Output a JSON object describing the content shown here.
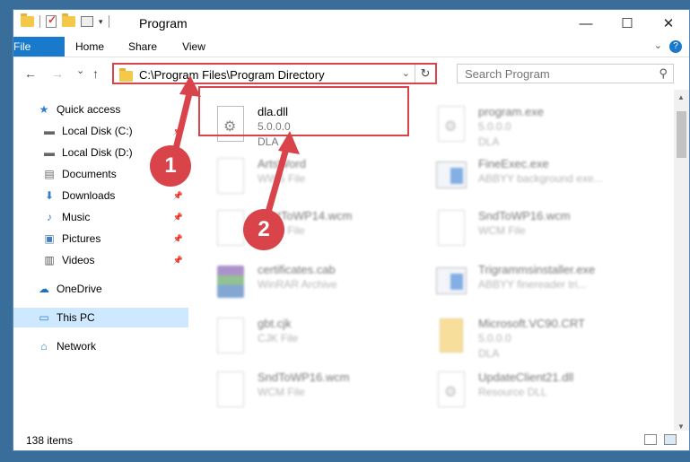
{
  "window": {
    "title": "Program",
    "controls": {
      "minimize": "—",
      "maximize": "☐",
      "close": "✕"
    }
  },
  "ribbon": {
    "tabs": [
      "File",
      "Home",
      "Share",
      "View"
    ],
    "help": "?"
  },
  "navigation": {
    "back": "←",
    "forward": "→",
    "recent": "⌄",
    "up": "↑",
    "address": "C:\\Program Files\\Program Directory",
    "refresh": "↻",
    "search_placeholder": "Search Program",
    "search_icon": "⚲"
  },
  "sidebar": {
    "items": [
      {
        "label": "Quick access",
        "icon": "star-icon",
        "glyph": "★",
        "color": "#2f7fd1"
      },
      {
        "label": "Local Disk (C:)",
        "icon": "drive-icon",
        "glyph": "▬",
        "color": "#666",
        "pinned": true
      },
      {
        "label": "Local Disk (D:)",
        "icon": "drive-icon",
        "glyph": "▬",
        "color": "#666",
        "pinned": true
      },
      {
        "label": "Documents",
        "icon": "documents-icon",
        "glyph": "▤",
        "color": "#666",
        "pinned": true
      },
      {
        "label": "Downloads",
        "icon": "download-icon",
        "glyph": "⬇",
        "color": "#2f7fd1",
        "pinned": true
      },
      {
        "label": "Music",
        "icon": "music-icon",
        "glyph": "♪",
        "color": "#2f7fd1",
        "pinned": true
      },
      {
        "label": "Pictures",
        "icon": "pictures-icon",
        "glyph": "▣",
        "color": "#4a7fb0",
        "pinned": true
      },
      {
        "label": "Videos",
        "icon": "videos-icon",
        "glyph": "▥",
        "color": "#555",
        "pinned": true
      },
      {
        "label": "OneDrive",
        "icon": "cloud-icon",
        "glyph": "☁",
        "color": "#1f6fc0"
      },
      {
        "label": "This PC",
        "icon": "computer-icon",
        "glyph": "▭",
        "color": "#2f7fd1",
        "selected": true
      },
      {
        "label": "Network",
        "icon": "network-icon",
        "glyph": "⌂",
        "color": "#2f7fd1"
      }
    ]
  },
  "files": [
    {
      "name": "dla.dll",
      "line2": "5.0.0.0",
      "line3": "DLA",
      "kind": "dll",
      "blur": false
    },
    {
      "name": "program.exe",
      "line2": "5.0.0.0",
      "line3": "DLA",
      "kind": "dll",
      "blur": true
    },
    {
      "name": "ArtsWord",
      "line2": "WWS File",
      "line3": "",
      "kind": "page",
      "blur": true
    },
    {
      "name": "FineExec.exe",
      "line2": "ABBYY background exe...",
      "line3": "",
      "kind": "appwin",
      "blur": true
    },
    {
      "name": "FontToWP14.wcm",
      "line2": "WCM File",
      "line3": "",
      "kind": "page",
      "blur": true
    },
    {
      "name": "SndToWP16.wcm",
      "line2": "WCM File",
      "line3": "",
      "kind": "page",
      "blur": true
    },
    {
      "name": "certificates.cab",
      "line2": "WinRAR Archive",
      "line3": "",
      "kind": "winrar",
      "blur": true
    },
    {
      "name": "Trigrammsinstaller.exe",
      "line2": "ABBYY finereader tri...",
      "line3": "",
      "kind": "appwin",
      "blur": true
    },
    {
      "name": "gbt.cjk",
      "line2": "CJK File",
      "line3": "",
      "kind": "page",
      "blur": true
    },
    {
      "name": "Microsoft.VC90.CRT",
      "line2": "5.0.0.0",
      "line3": "DLA",
      "kind": "zip",
      "blur": true
    },
    {
      "name": "SndToWP16.wcm",
      "line2": "WCM File",
      "line3": "",
      "kind": "page",
      "blur": true
    },
    {
      "name": "UpdateClient21.dll",
      "line2": "Resource DLL",
      "line3": "",
      "kind": "dll",
      "blur": true
    }
  ],
  "status": {
    "count": "138 items"
  },
  "annotations": {
    "badge1": "1",
    "badge2": "2",
    "color": "#d9434a"
  }
}
